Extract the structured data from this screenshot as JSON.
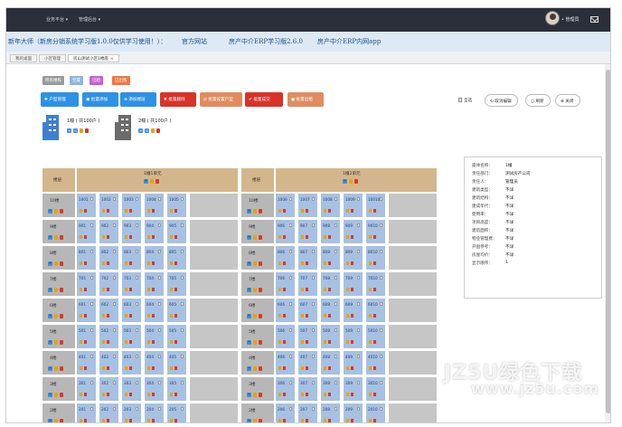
{
  "topbar": {
    "menu1": "业务平台 ▾",
    "menu2": "管理后台 ▾",
    "user": "• 管理员"
  },
  "notice": {
    "text1": "新年大师（新房分销系统学习版1.0.0仅供学习使用！）：",
    "link1": "官方网站",
    "link2": "房产中介ERP学习版2.6.0",
    "link3": "房产中介ERP内网app"
  },
  "tabs": [
    {
      "label": "我的桌面"
    },
    {
      "label": "小区管理"
    },
    {
      "label": "房山测试小区1楼座",
      "close": "×"
    }
  ],
  "filters": [
    {
      "label": "所有楼栋",
      "color": "#9a9a9a"
    },
    {
      "label": "空置",
      "color": "#8fb6de"
    },
    {
      "label": "已租",
      "color": "#c761d4"
    },
    {
      "label": "已出售",
      "color": "#f07842"
    }
  ],
  "actions": [
    {
      "label": "✚ 户型管理",
      "color": "#2e91e6"
    },
    {
      "label": "▣ 批量添加",
      "color": "#2e91e6"
    },
    {
      "label": "⊕ 添加楼层",
      "color": "#2e91e6"
    },
    {
      "label": "✖ 批量删除",
      "color": "#d9322a"
    },
    {
      "label": "⇄ 批量设置户型",
      "color": "#e08c60"
    },
    {
      "label": "✔ 批量成交",
      "color": "#d9322a"
    },
    {
      "label": "● 批量出租",
      "color": "#e08c60"
    }
  ],
  "right_buttons": {
    "selectall": "全选",
    "cancel": "↻ 取消编辑",
    "refresh": "○ 刷新",
    "close": "⊗ 关闭"
  },
  "buildings": [
    {
      "label": "1幢 ( 共100户 )"
    },
    {
      "label": "2幢 ( 共100户 )"
    }
  ],
  "grid_left": {
    "floor_header": "楼层",
    "unit_header": "1幢1单元",
    "rows": [
      {
        "floor": "10楼",
        "rooms": [
          "1001",
          "1002",
          "1003",
          "1004",
          "1005"
        ]
      },
      {
        "floor": "9楼",
        "rooms": [
          "901",
          "902",
          "903",
          "904",
          "905"
        ]
      },
      {
        "floor": "8楼",
        "rooms": [
          "801",
          "802",
          "803",
          "804",
          "805"
        ]
      },
      {
        "floor": "7楼",
        "rooms": [
          "701",
          "702",
          "703",
          "704",
          "705"
        ]
      },
      {
        "floor": "6楼",
        "rooms": [
          "601",
          "602",
          "603",
          "604",
          "605"
        ]
      },
      {
        "floor": "5楼",
        "rooms": [
          "501",
          "502",
          "503",
          "504",
          "505"
        ]
      },
      {
        "floor": "4楼",
        "rooms": [
          "401",
          "402",
          "403",
          "404",
          "405"
        ]
      },
      {
        "floor": "3楼",
        "rooms": [
          "301",
          "302",
          "303",
          "304",
          "305"
        ]
      },
      {
        "floor": "2楼",
        "rooms": [
          "201",
          "202",
          "203",
          "204",
          "205"
        ]
      }
    ]
  },
  "grid_right": {
    "floor_header": "楼层",
    "unit_header": "1幢2单元",
    "rows": [
      {
        "floor": "10楼",
        "rooms": [
          "1006",
          "1007",
          "1008",
          "1009",
          "10010"
        ]
      },
      {
        "floor": "9楼",
        "rooms": [
          "906",
          "907",
          "908",
          "909",
          "9010"
        ]
      },
      {
        "floor": "8楼",
        "rooms": [
          "806",
          "807",
          "808",
          "809",
          "8010"
        ]
      },
      {
        "floor": "7楼",
        "rooms": [
          "706",
          "707",
          "708",
          "709",
          "7010"
        ]
      },
      {
        "floor": "6楼",
        "rooms": [
          "606",
          "607",
          "608",
          "609",
          "6010"
        ]
      },
      {
        "floor": "5楼",
        "rooms": [
          "506",
          "507",
          "508",
          "509",
          "5010"
        ]
      },
      {
        "floor": "4楼",
        "rooms": [
          "406",
          "407",
          "408",
          "409",
          "4010"
        ]
      },
      {
        "floor": "3楼",
        "rooms": [
          "306",
          "307",
          "308",
          "309",
          "3010"
        ]
      },
      {
        "floor": "2楼",
        "rooms": [
          "206",
          "207",
          "208",
          "209",
          "2010"
        ]
      }
    ]
  },
  "info": [
    {
      "k": "座体名称：",
      "v": "1幢"
    },
    {
      "k": "责任部门：",
      "v": "测试房产公司"
    },
    {
      "k": "责任人：",
      "v": "管理员"
    },
    {
      "k": "建筑类型：",
      "v": "不详"
    },
    {
      "k": "建筑结构：",
      "v": "不详"
    },
    {
      "k": "建成年代：",
      "v": "不详"
    },
    {
      "k": "使用率：",
      "v": "不详"
    },
    {
      "k": "项目高度：",
      "v": "不详"
    },
    {
      "k": "建筑面积：",
      "v": "不详"
    },
    {
      "k": "物业管理费：",
      "v": "不详"
    },
    {
      "k": "开盘参考：",
      "v": "不详"
    },
    {
      "k": "房屋均价：",
      "v": "不详"
    },
    {
      "k": "显示顺序：",
      "v": "1"
    }
  ],
  "watermark": {
    "line1": "JZ5U绿色下载",
    "line2": "www.jz5u.com"
  }
}
